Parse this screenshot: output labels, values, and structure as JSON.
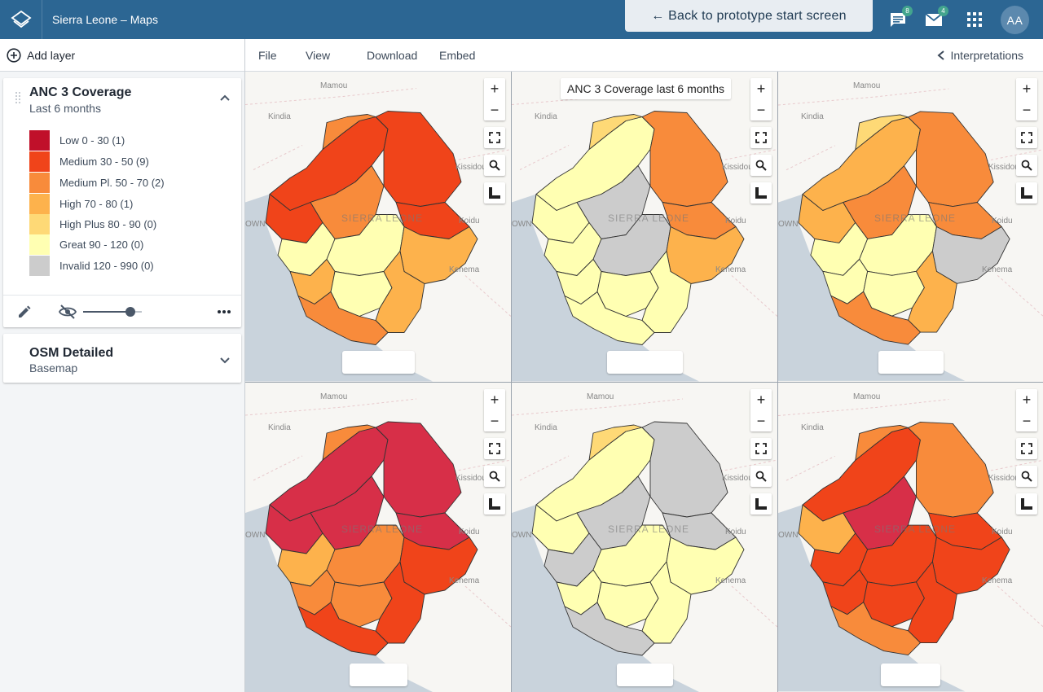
{
  "header": {
    "app_title": "Sierra Leone – Maps",
    "back_button": "← Back to prototype start screen",
    "messages_count": "8",
    "mail_count": "4",
    "avatar_initials": "AA"
  },
  "sidebar": {
    "add_layer": "Add layer",
    "layers": [
      {
        "title": "ANC 3 Coverage",
        "subtitle": "Last 6 months",
        "legend": [
          {
            "label": "Low 0 - 30 (1)",
            "color": "#c0102a"
          },
          {
            "label": "Medium 30 - 50 (9)",
            "color": "#f0441a"
          },
          {
            "label": "Medium Pl. 50 - 70 (2)",
            "color": "#f88b3b"
          },
          {
            "label": "High 70 - 80 (1)",
            "color": "#fdb24c"
          },
          {
            "label": "High Plus 80 - 90 (0)",
            "color": "#fed976"
          },
          {
            "label": "Great 90 - 120 (0)",
            "color": "#ffffb2"
          },
          {
            "label": "Invalid 120 - 990 (0)",
            "color": "#cccccc"
          }
        ]
      },
      {
        "title": "OSM Detailed",
        "subtitle": "Basemap"
      }
    ]
  },
  "toolbar": {
    "file": "File",
    "view": "View",
    "download": "Download",
    "embed": "Embed",
    "interpretations": "Interpretations"
  },
  "maps": {
    "title_overlay": "ANC 3 Coverage last 6 months",
    "place_labels": [
      "Mamou",
      "Kindia",
      "Kissidougou",
      "Koidu",
      "Kenema",
      "SIERRA LEONE",
      "OWN"
    ]
  },
  "colors": {
    "header_bg": "#2c6693",
    "badge": "#43a58e"
  }
}
